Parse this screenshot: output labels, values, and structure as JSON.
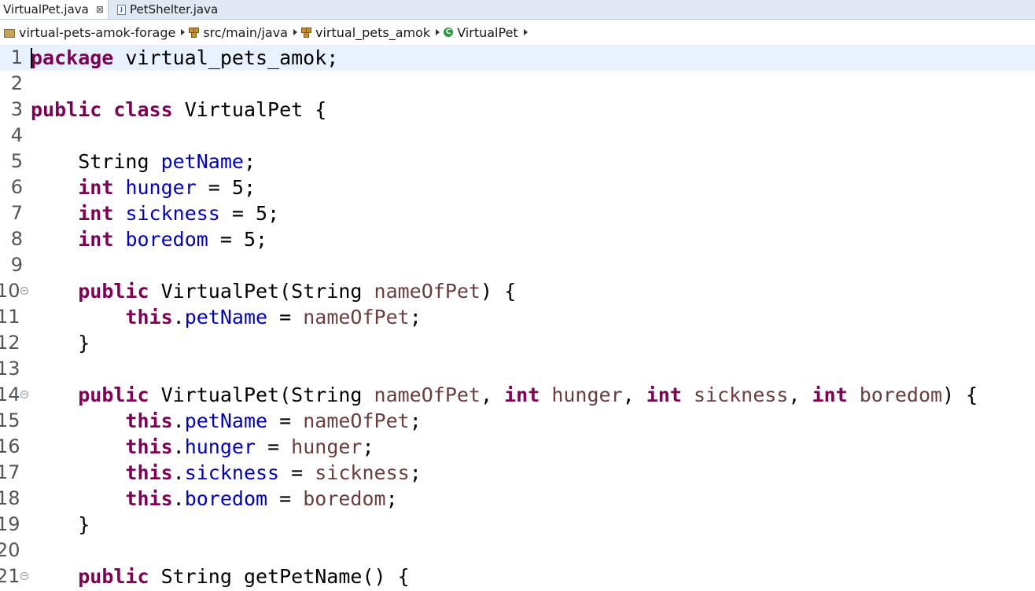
{
  "tabs": [
    {
      "label": "VirtualPet.java",
      "close": "⊠",
      "active": true
    },
    {
      "label": "PetShelter.java",
      "active": false
    }
  ],
  "breadcrumb": {
    "project": "virtual-pets-amok-forage",
    "source_folder": "src/main/java",
    "package": "virtual_pets_amok",
    "class": "VirtualPet"
  },
  "editor": {
    "current_line": 1,
    "lines": [
      {
        "n": "1",
        "tokens": [
          {
            "t": "kw",
            "v": "package"
          },
          {
            "t": "p",
            "v": " virtual_pets_amok;"
          }
        ]
      },
      {
        "n": "2",
        "tokens": []
      },
      {
        "n": "3",
        "tokens": [
          {
            "t": "kw",
            "v": "public"
          },
          {
            "t": "p",
            "v": " "
          },
          {
            "t": "kw",
            "v": "class"
          },
          {
            "t": "p",
            "v": " VirtualPet {"
          }
        ]
      },
      {
        "n": "4",
        "tokens": []
      },
      {
        "n": "5",
        "tokens": [
          {
            "t": "p",
            "v": "    String "
          },
          {
            "t": "fld",
            "v": "petName"
          },
          {
            "t": "p",
            "v": ";"
          }
        ]
      },
      {
        "n": "6",
        "tokens": [
          {
            "t": "p",
            "v": "    "
          },
          {
            "t": "kw",
            "v": "int"
          },
          {
            "t": "p",
            "v": " "
          },
          {
            "t": "fld",
            "v": "hunger"
          },
          {
            "t": "p",
            "v": " = 5;"
          }
        ]
      },
      {
        "n": "7",
        "tokens": [
          {
            "t": "p",
            "v": "    "
          },
          {
            "t": "kw",
            "v": "int"
          },
          {
            "t": "p",
            "v": " "
          },
          {
            "t": "fld",
            "v": "sickness"
          },
          {
            "t": "p",
            "v": " = 5;"
          }
        ]
      },
      {
        "n": "8",
        "tokens": [
          {
            "t": "p",
            "v": "    "
          },
          {
            "t": "kw",
            "v": "int"
          },
          {
            "t": "p",
            "v": " "
          },
          {
            "t": "fld",
            "v": "boredom"
          },
          {
            "t": "p",
            "v": " = 5;"
          }
        ]
      },
      {
        "n": "9",
        "tokens": []
      },
      {
        "n": "10",
        "fold": true,
        "tokens": [
          {
            "t": "p",
            "v": "    "
          },
          {
            "t": "kw",
            "v": "public"
          },
          {
            "t": "p",
            "v": " VirtualPet(String "
          },
          {
            "t": "par",
            "v": "nameOfPet"
          },
          {
            "t": "p",
            "v": ") {"
          }
        ]
      },
      {
        "n": "11",
        "tokens": [
          {
            "t": "p",
            "v": "        "
          },
          {
            "t": "kw",
            "v": "this"
          },
          {
            "t": "p",
            "v": "."
          },
          {
            "t": "fld",
            "v": "petName"
          },
          {
            "t": "p",
            "v": " = "
          },
          {
            "t": "par",
            "v": "nameOfPet"
          },
          {
            "t": "p",
            "v": ";"
          }
        ]
      },
      {
        "n": "12",
        "tokens": [
          {
            "t": "p",
            "v": "    }"
          }
        ]
      },
      {
        "n": "13",
        "tokens": []
      },
      {
        "n": "14",
        "fold": true,
        "tokens": [
          {
            "t": "p",
            "v": "    "
          },
          {
            "t": "kw",
            "v": "public"
          },
          {
            "t": "p",
            "v": " VirtualPet(String "
          },
          {
            "t": "par",
            "v": "nameOfPet"
          },
          {
            "t": "p",
            "v": ", "
          },
          {
            "t": "kw",
            "v": "int"
          },
          {
            "t": "p",
            "v": " "
          },
          {
            "t": "par",
            "v": "hunger"
          },
          {
            "t": "p",
            "v": ", "
          },
          {
            "t": "kw",
            "v": "int"
          },
          {
            "t": "p",
            "v": " "
          },
          {
            "t": "par",
            "v": "sickness"
          },
          {
            "t": "p",
            "v": ", "
          },
          {
            "t": "kw",
            "v": "int"
          },
          {
            "t": "p",
            "v": " "
          },
          {
            "t": "par",
            "v": "boredom"
          },
          {
            "t": "p",
            "v": ") {"
          }
        ]
      },
      {
        "n": "15",
        "tokens": [
          {
            "t": "p",
            "v": "        "
          },
          {
            "t": "kw",
            "v": "this"
          },
          {
            "t": "p",
            "v": "."
          },
          {
            "t": "fld",
            "v": "petName"
          },
          {
            "t": "p",
            "v": " = "
          },
          {
            "t": "par",
            "v": "nameOfPet"
          },
          {
            "t": "p",
            "v": ";"
          }
        ]
      },
      {
        "n": "16",
        "tokens": [
          {
            "t": "p",
            "v": "        "
          },
          {
            "t": "kw",
            "v": "this"
          },
          {
            "t": "p",
            "v": "."
          },
          {
            "t": "fld",
            "v": "hunger"
          },
          {
            "t": "p",
            "v": " = "
          },
          {
            "t": "par",
            "v": "hunger"
          },
          {
            "t": "p",
            "v": ";"
          }
        ]
      },
      {
        "n": "17",
        "tokens": [
          {
            "t": "p",
            "v": "        "
          },
          {
            "t": "kw",
            "v": "this"
          },
          {
            "t": "p",
            "v": "."
          },
          {
            "t": "fld",
            "v": "sickness"
          },
          {
            "t": "p",
            "v": " = "
          },
          {
            "t": "par",
            "v": "sickness"
          },
          {
            "t": "p",
            "v": ";"
          }
        ]
      },
      {
        "n": "18",
        "tokens": [
          {
            "t": "p",
            "v": "        "
          },
          {
            "t": "kw",
            "v": "this"
          },
          {
            "t": "p",
            "v": "."
          },
          {
            "t": "fld",
            "v": "boredom"
          },
          {
            "t": "p",
            "v": " = "
          },
          {
            "t": "par",
            "v": "boredom"
          },
          {
            "t": "p",
            "v": ";"
          }
        ]
      },
      {
        "n": "19",
        "tokens": [
          {
            "t": "p",
            "v": "    }"
          }
        ]
      },
      {
        "n": "20",
        "tokens": []
      },
      {
        "n": "21",
        "fold": true,
        "tokens": [
          {
            "t": "p",
            "v": "    "
          },
          {
            "t": "kw",
            "v": "public"
          },
          {
            "t": "p",
            "v": " String getPetName() {"
          }
        ]
      }
    ]
  },
  "colors": {
    "keyword": "#7f0055",
    "field": "#0000c0",
    "parameter": "#6a3e3e",
    "current_line": "#e8f2fe"
  }
}
